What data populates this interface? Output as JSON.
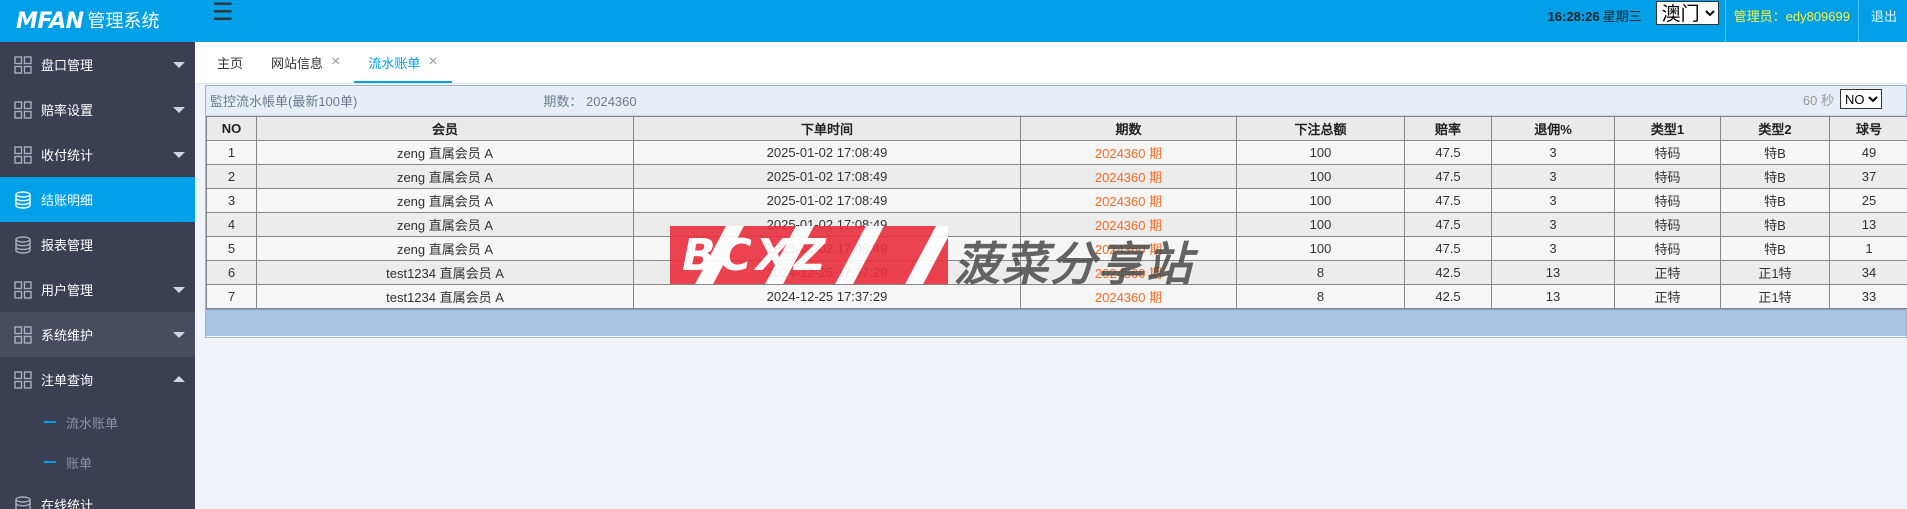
{
  "header": {
    "logo_mark": "MFAN",
    "logo_text": "管理系统",
    "time": "16:28:26",
    "weekday": "星期三",
    "region_selected": "澳门",
    "region_options": [
      "澳门"
    ],
    "admin_label": "管理员：edy809699",
    "logout": "退出"
  },
  "sidebar": {
    "items": [
      {
        "label": "盘口管理",
        "icon": "grid-icon",
        "arrow": "down"
      },
      {
        "label": "赔率设置",
        "icon": "grid-icon",
        "arrow": "down"
      },
      {
        "label": "收付统计",
        "icon": "grid-icon",
        "arrow": "down"
      },
      {
        "label": "结账明细",
        "icon": "database-icon",
        "active": true
      },
      {
        "label": "报表管理",
        "icon": "database-icon"
      },
      {
        "label": "用户管理",
        "icon": "grid-icon",
        "arrow": "down"
      },
      {
        "label": "系统维护",
        "icon": "grid-icon",
        "arrow": "down"
      },
      {
        "label": "注单查询",
        "icon": "grid-icon",
        "arrow": "up"
      }
    ],
    "sub_items": [
      "流水账单",
      "账单"
    ],
    "last_item": "在线统计"
  },
  "tabs": [
    {
      "label": "主页",
      "closable": false
    },
    {
      "label": "网站信息",
      "closable": true
    },
    {
      "label": "流水账单",
      "closable": true,
      "active": true
    }
  ],
  "panel": {
    "title": "監控流水帳单(最新100单)",
    "period_label": "期数：",
    "period_value": "2024360",
    "refresh_seconds": "60 秒",
    "refresh_selected": "NO",
    "refresh_options": [
      "NO"
    ]
  },
  "table": {
    "columns": [
      "NO",
      "会员",
      "下单时间",
      "期数",
      "下注总额",
      "赔率",
      "退佣%",
      "类型1",
      "类型2",
      "球号"
    ],
    "rows": [
      [
        "1",
        "zeng 直属会员 A",
        "2025-01-02 17:08:49",
        "2024360 期",
        "100",
        "47.5",
        "3",
        "特码",
        "特B",
        "49"
      ],
      [
        "2",
        "zeng 直属会员 A",
        "2025-01-02 17:08:49",
        "2024360 期",
        "100",
        "47.5",
        "3",
        "特码",
        "特B",
        "37"
      ],
      [
        "3",
        "zeng 直属会员 A",
        "2025-01-02 17:08:49",
        "2024360 期",
        "100",
        "47.5",
        "3",
        "特码",
        "特B",
        "25"
      ],
      [
        "4",
        "zeng 直属会员 A",
        "2025-01-02 17:08:49",
        "2024360 期",
        "100",
        "47.5",
        "3",
        "特码",
        "特B",
        "13"
      ],
      [
        "5",
        "zeng 直属会员 A",
        "2025-01-02 17:08:49",
        "2024360 期",
        "100",
        "47.5",
        "3",
        "特码",
        "特B",
        "1"
      ],
      [
        "6",
        "test1234 直属会员 A",
        "2024-12-25 17:37:29",
        "2024360 期",
        "8",
        "42.5",
        "13",
        "正特",
        "正1特",
        "34"
      ],
      [
        "7",
        "test1234 直属会员 A",
        "2024-12-25 17:37:29",
        "2024360 期",
        "8",
        "42.5",
        "13",
        "正特",
        "正1特",
        "33"
      ]
    ]
  },
  "watermark": {
    "logo": "BCXZ",
    "text": "菠菜分享站"
  },
  "colors": {
    "header_bg": "#00a0e9",
    "sidebar_bg": "#3a3f51",
    "period_text": "#f26d21",
    "admin_text": "#ffef3a"
  }
}
